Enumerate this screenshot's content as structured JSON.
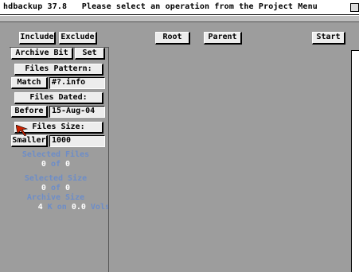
{
  "title": "hdbackup 37.8   Please select an operation from the Project Menu",
  "toolbar": {
    "include": "Include",
    "exclude": "Exclude",
    "root": "Root",
    "parent": "Parent",
    "start": "Start"
  },
  "options": {
    "archive_bit": "Archive Bit",
    "set": "Set",
    "files_pattern_label": "Files Pattern:",
    "match": "Match",
    "pattern_value": "#?.info",
    "files_dated_label": "Files Dated:",
    "before": "Before",
    "date_value": "15-Aug-04",
    "files_size_label": "Files Size:",
    "smaller": "Smaller",
    "size_value": "1000"
  },
  "stats": {
    "selected_files_label": "Selected Files",
    "selected_files_count": "0",
    "of_word_1": "of",
    "selected_files_total": "0",
    "selected_size_label": "Selected Size",
    "selected_size_value": "0",
    "of_word_2": "of",
    "selected_size_total": "0",
    "archive_size_label": "Archive Size",
    "archive_size_value": "4",
    "archive_k_on": "K on",
    "archive_vols_value": "0.0",
    "archive_vols_label": "Vols"
  },
  "colors": {
    "window_bg": "#9d9d9d",
    "label_blue": "#6d8dc8",
    "pointer_red": "#cc2200"
  },
  "icons": {
    "pointer": "mouse-pointer-icon",
    "depth_gadget": "depth-gadget-icon"
  }
}
